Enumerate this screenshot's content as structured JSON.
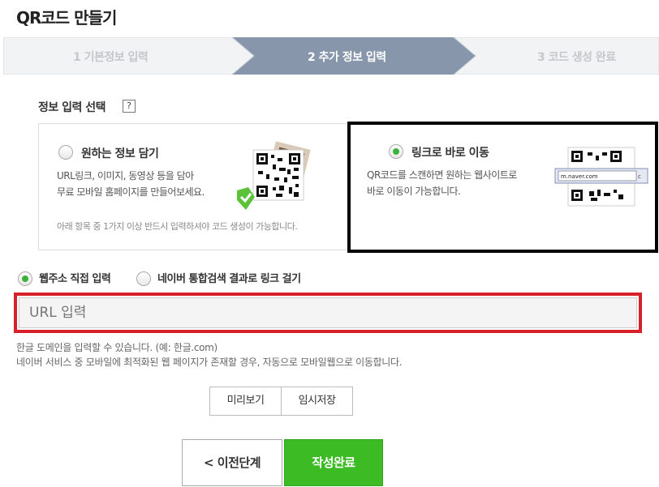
{
  "page": {
    "title": "QR코드 만들기"
  },
  "steps": [
    {
      "label": "1 기본정보 입력",
      "state": "done"
    },
    {
      "label": "2 추가 정보 입력",
      "state": "active"
    },
    {
      "label": "3 코드 생성 완료",
      "state": "pending"
    }
  ],
  "section": {
    "label": "정보 입력 선택",
    "help": "?"
  },
  "options": {
    "left": {
      "title": "원하는 정보 담기",
      "desc_line1": "URL링크, 이미지, 동영상 등을 담아",
      "desc_line2": "무료 모바일 홈페이지를 만들어보세요.",
      "note": "아래 항목 중 1가지 이상 반드시 입력하셔야 코드 생성이 가능합니다.",
      "selected": false
    },
    "right": {
      "title": "링크로 바로 이동",
      "desc_line1": "QR코드를 스캔하면 원하는 웹사이트로",
      "desc_line2": "바로 이동이 가능합니다.",
      "url_sample": "m.naver.com",
      "selected": true
    }
  },
  "link_choice": {
    "direct": "웹주소 직접 입력",
    "search": "네이버 통합검색 결과로 링크 걸기",
    "selected": "direct"
  },
  "url_field": {
    "placeholder": "URL 입력",
    "value": ""
  },
  "hints": {
    "line1": "한글 도메인을 입력할 수 있습니다. (예: 한글.com)",
    "line2": "네이버 서비스 중 모바일에 최적화된 웹 페이지가 존재할 경우, 자동으로 모바일웹으로 이동합니다."
  },
  "buttons": {
    "preview": "미리보기",
    "temp_save": "임시저장",
    "prev": "< 이전단계",
    "done": "작성완료"
  },
  "colors": {
    "active_step": "#8796ab",
    "primary": "#3dbb25",
    "highlight_red": "#d6202a"
  }
}
